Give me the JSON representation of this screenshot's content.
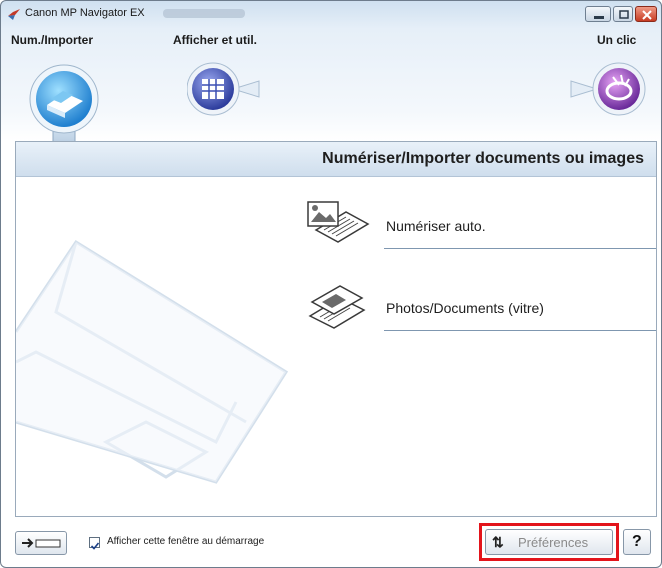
{
  "window": {
    "title": "Canon MP Navigator EX"
  },
  "modes": [
    {
      "label": "Num./Importer",
      "icon": "scanner-icon",
      "selected": true
    },
    {
      "label": "Afficher et util.",
      "icon": "grid-view-icon",
      "selected": false
    },
    {
      "label": "Un clic",
      "icon": "one-click-icon",
      "selected": false
    }
  ],
  "content": {
    "title": "Numériser/Importer documents ou images",
    "items": [
      {
        "label": "Numériser auto.",
        "icon": "auto-scan-icon"
      },
      {
        "label": "Photos/Documents (vitre)",
        "icon": "platen-scan-icon"
      }
    ]
  },
  "footer": {
    "startup_checkbox_label": "Afficher cette fenêtre au démarrage",
    "startup_checked": true,
    "preferences_label": "Préférences",
    "help_label": "?"
  },
  "colors": {
    "highlight": "#e3141b",
    "selected_mode": "#2f9be0",
    "view_mode": "#3b4fb3",
    "one_click_mode": "#8a3fb8"
  }
}
